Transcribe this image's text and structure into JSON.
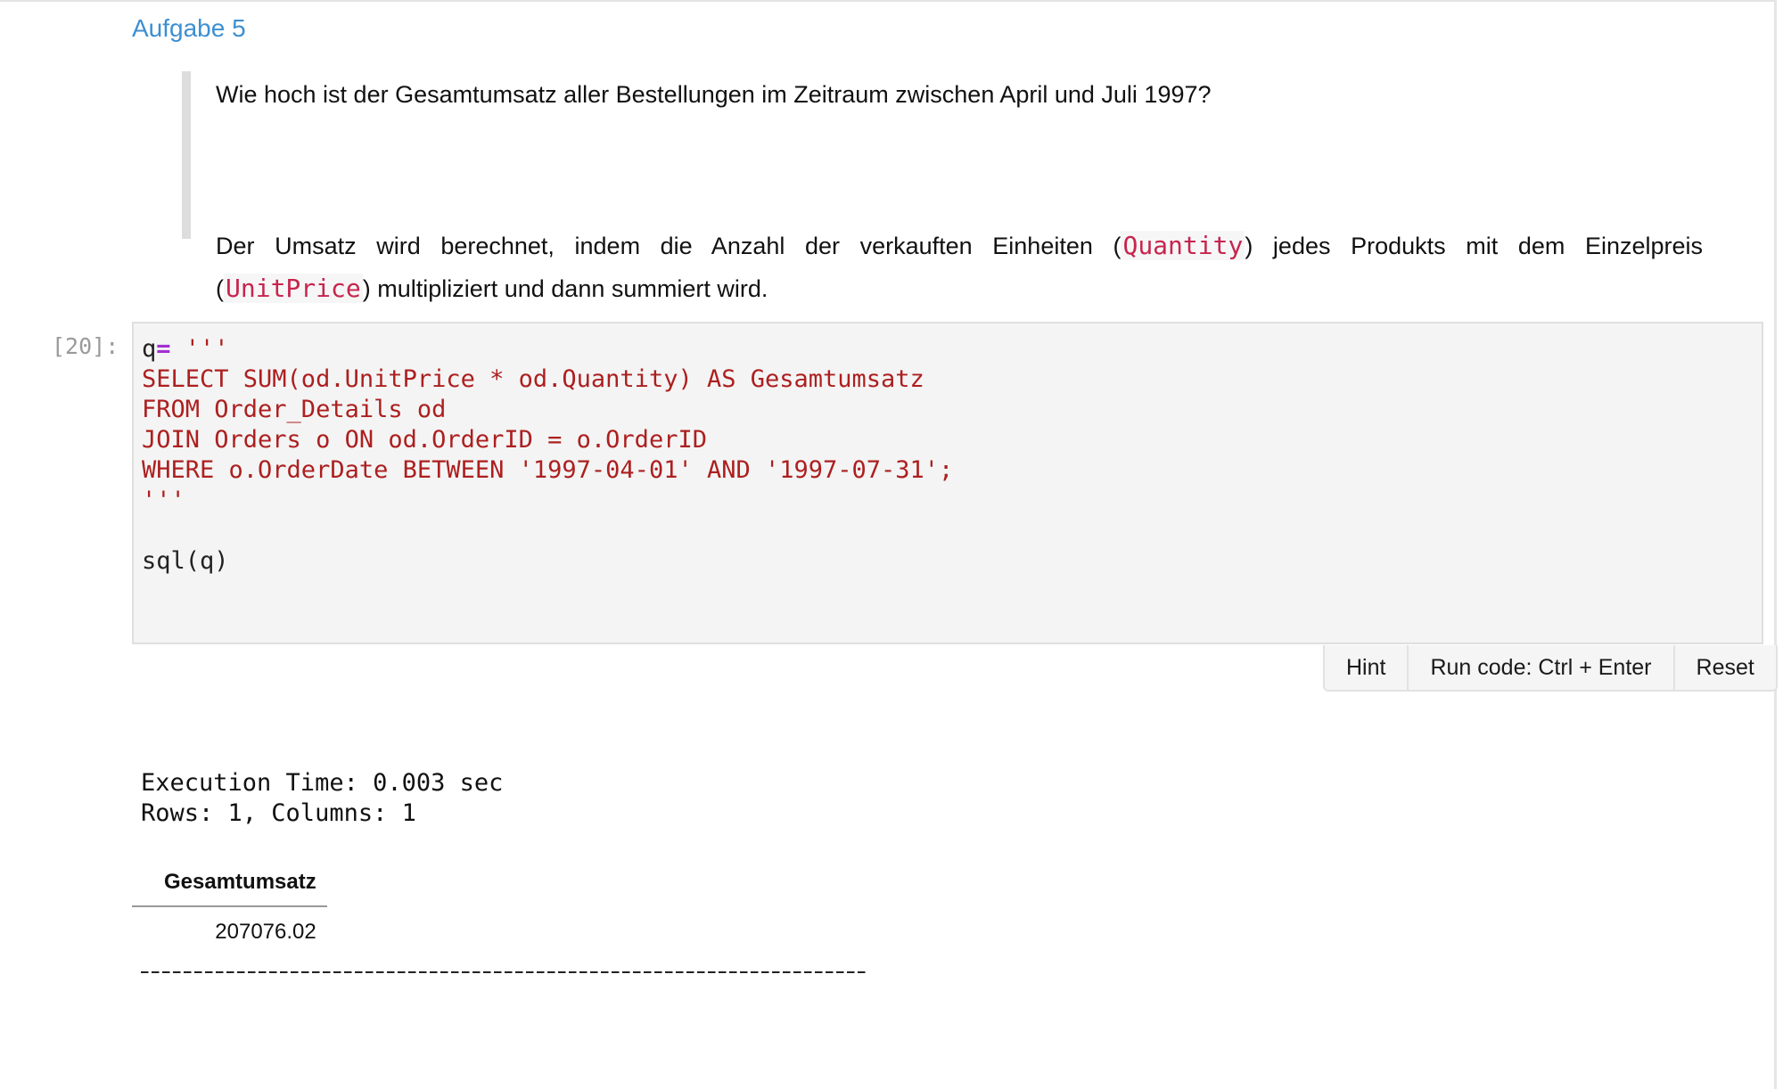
{
  "task": {
    "title": "Aufgabe 5",
    "question": "Wie hoch ist der Gesamtumsatz aller Bestellungen im Zeitraum zwischen April und Juli 1997?",
    "explanation_part1": "Der Umsatz wird berechnet, indem die Anzahl der verkauften Einheiten (",
    "code1": "Quantity",
    "explanation_part2": ") jedes Produkts mit dem Einzelpreis",
    "explanation_part3_open": "(",
    "code2": "UnitPrice",
    "explanation_part4": ") multipliziert und dann summiert wird."
  },
  "cell": {
    "prompt": "[20]:",
    "code_var": "q",
    "code_op": "=",
    "code_open": " '''",
    "code_sql": "SELECT SUM(od.UnitPrice * od.Quantity) AS Gesamtumsatz\nFROM Order_Details od\nJOIN Orders o ON od.OrderID = o.OrderID\nWHERE o.OrderDate BETWEEN '1997-04-01' AND '1997-07-31';\n'''",
    "code_call": "sql(q)"
  },
  "buttons": {
    "hint": "Hint",
    "run": "Run code: Ctrl + Enter",
    "reset": "Reset"
  },
  "output": {
    "execution_time": "Execution Time: 0.003 sec",
    "rows_columns": "Rows: 1, Columns: 1",
    "table": {
      "header": "Gesamtumsatz",
      "value": "207076.02"
    }
  }
}
